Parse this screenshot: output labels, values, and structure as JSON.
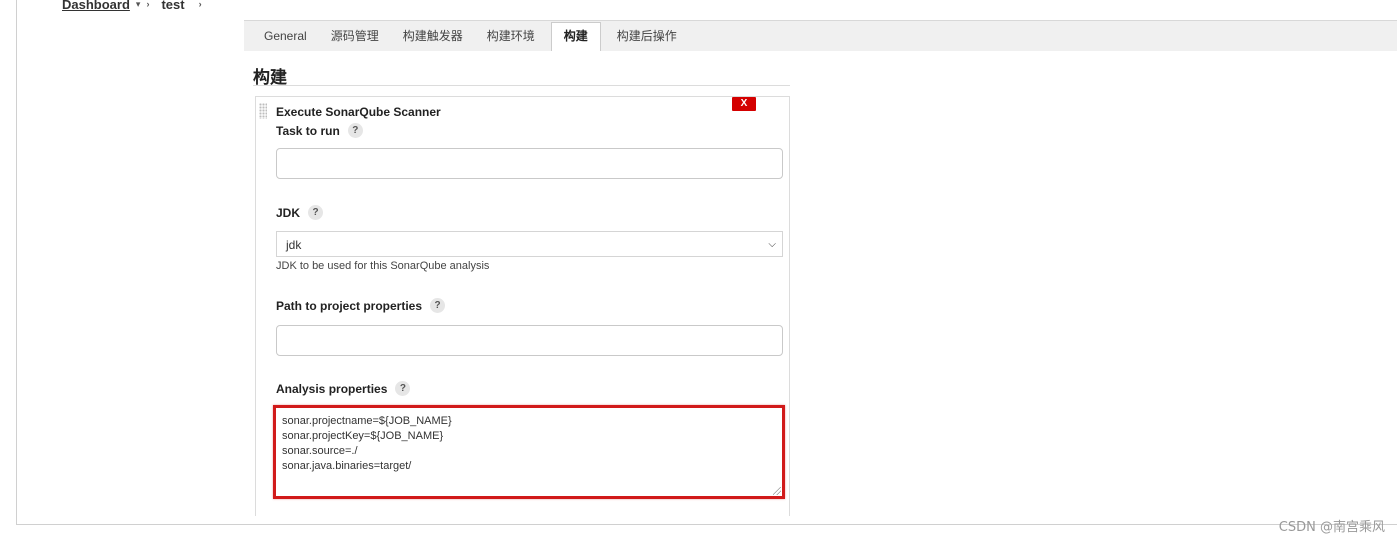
{
  "breadcrumb": {
    "dashboard": "Dashboard",
    "dashboard_arrow": "▾",
    "sep": "›",
    "job": "test",
    "job_arrow": "›"
  },
  "tabs": [
    {
      "label": "General"
    },
    {
      "label": "源码管理"
    },
    {
      "label": "构建触发器"
    },
    {
      "label": "构建环境"
    },
    {
      "label": "构建",
      "active": true
    },
    {
      "label": "构建后操作"
    }
  ],
  "section": {
    "title": "构建"
  },
  "step": {
    "title": "Execute SonarQube Scanner",
    "delete_label": "X",
    "task": {
      "label": "Task to run",
      "help": "?",
      "value": ""
    },
    "jdk": {
      "label": "JDK",
      "help": "?",
      "selected": "jdk",
      "description": "JDK to be used for this SonarQube analysis"
    },
    "path": {
      "label": "Path to project properties",
      "help": "?",
      "value": ""
    },
    "analysis": {
      "label": "Analysis properties",
      "help": "?",
      "lines": [
        "sonar.projectname=${JOB_NAME}",
        "sonar.projectKey=${JOB_NAME}",
        "sonar.source=./",
        "sonar.java.binaries=target/"
      ]
    }
  },
  "watermark": "CSDN @南宫乘风",
  "colors": {
    "highlight": "#d11a1a",
    "delete": "#d40000"
  }
}
